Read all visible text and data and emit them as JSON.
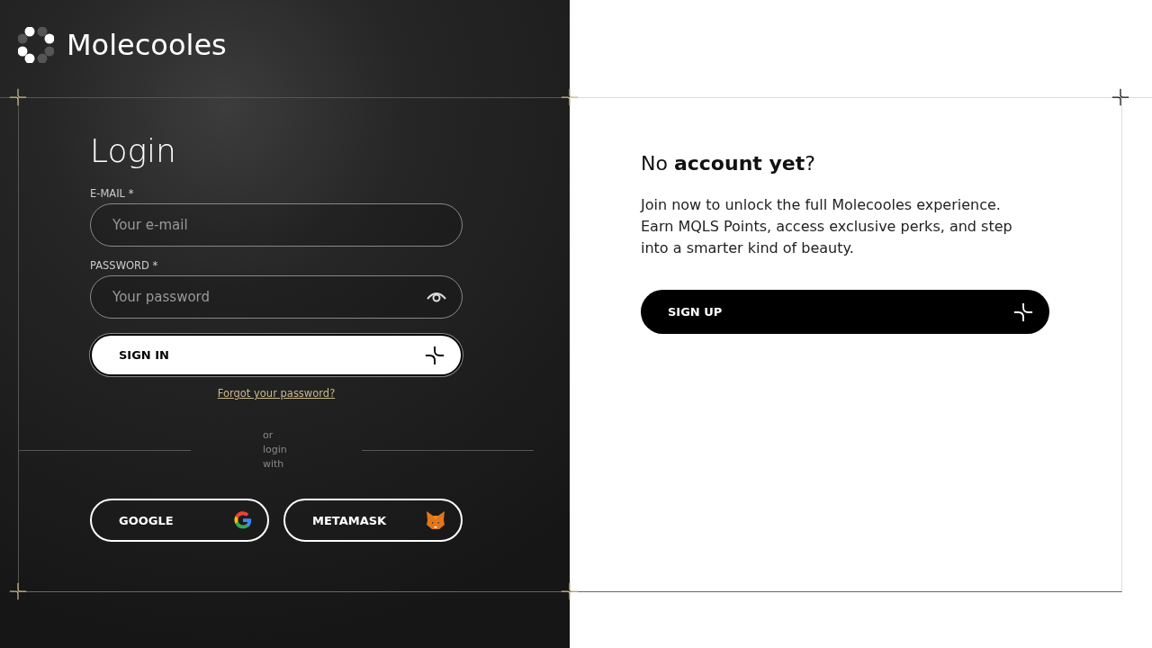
{
  "brand": {
    "name": "Molecooles"
  },
  "login": {
    "title": "Login",
    "fields": [
      {
        "label": "E-MAIL *",
        "placeholder": "Your e-mail",
        "kind": "email"
      },
      {
        "label": "PASSWORD *",
        "placeholder": "Your password",
        "kind": "password"
      }
    ],
    "submit": "SIGN IN",
    "forgot": "Forgot your password?",
    "divider": [
      "or",
      "login",
      "with"
    ],
    "providers": [
      {
        "label": "GOOGLE",
        "kind": "google"
      },
      {
        "label": "METAMASK",
        "kind": "metamask"
      }
    ]
  },
  "signup": {
    "heading": "No **account yet**?",
    "text": "Join now to unlock the full Molecooles experience. Earn MQLS Points, access exclusive perks, and step into a smarter kind of beauty.",
    "button": "SIGN UP"
  }
}
